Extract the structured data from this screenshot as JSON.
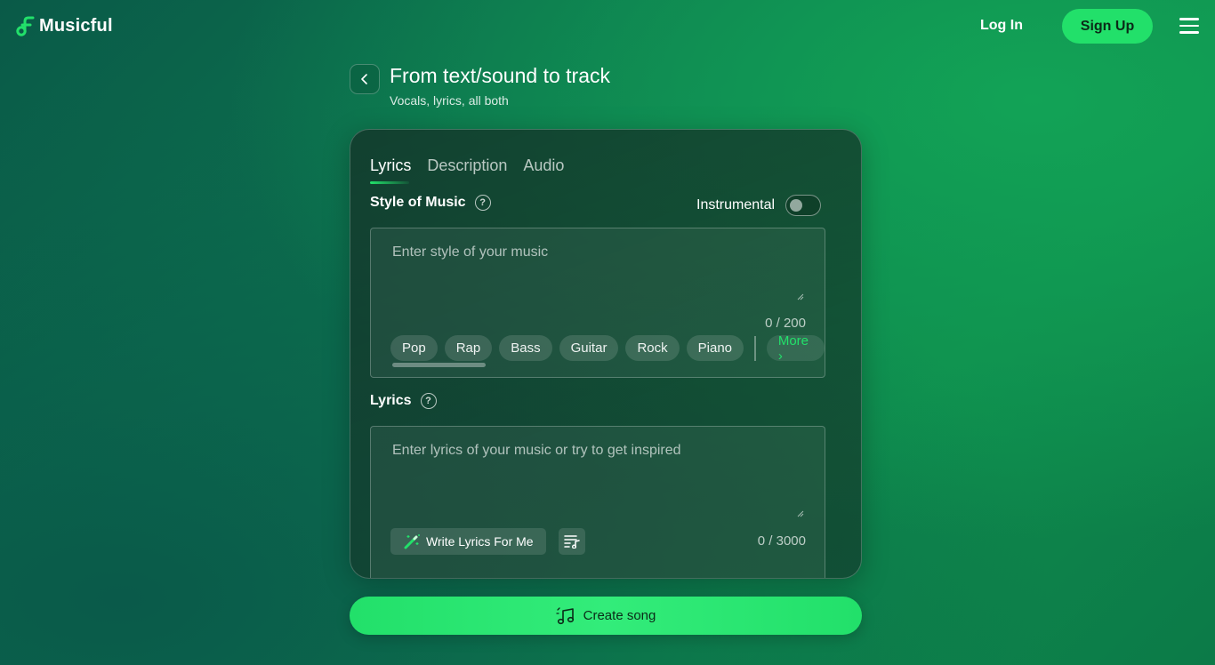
{
  "header": {
    "logo_text": "Musicful",
    "login_label": "Log In",
    "signup_label": "Sign Up"
  },
  "page": {
    "title": "From text/sound to track",
    "subtitle": "Vocals, lyrics, all both"
  },
  "tabs": [
    {
      "label": "Lyrics",
      "active": true
    },
    {
      "label": "Description",
      "active": false
    },
    {
      "label": "Audio",
      "active": false
    }
  ],
  "style_section": {
    "label": "Style of Music",
    "instrumental_label": "Instrumental",
    "instrumental_on": false,
    "placeholder": "Enter style of your music",
    "value": "",
    "counter": "0 / 200",
    "chips": [
      "Pop",
      "Rap",
      "Bass",
      "Guitar",
      "Rock",
      "Piano"
    ],
    "more_label": "More ›"
  },
  "lyrics_section": {
    "label": "Lyrics",
    "placeholder": "Enter lyrics of your music or try to get inspired",
    "value": "",
    "counter": "0 / 3000",
    "write_button_label": "Write Lyrics For Me"
  },
  "create_button_label": "Create song",
  "colors": {
    "accent": "#22e06a",
    "background": "#0d7a50"
  }
}
